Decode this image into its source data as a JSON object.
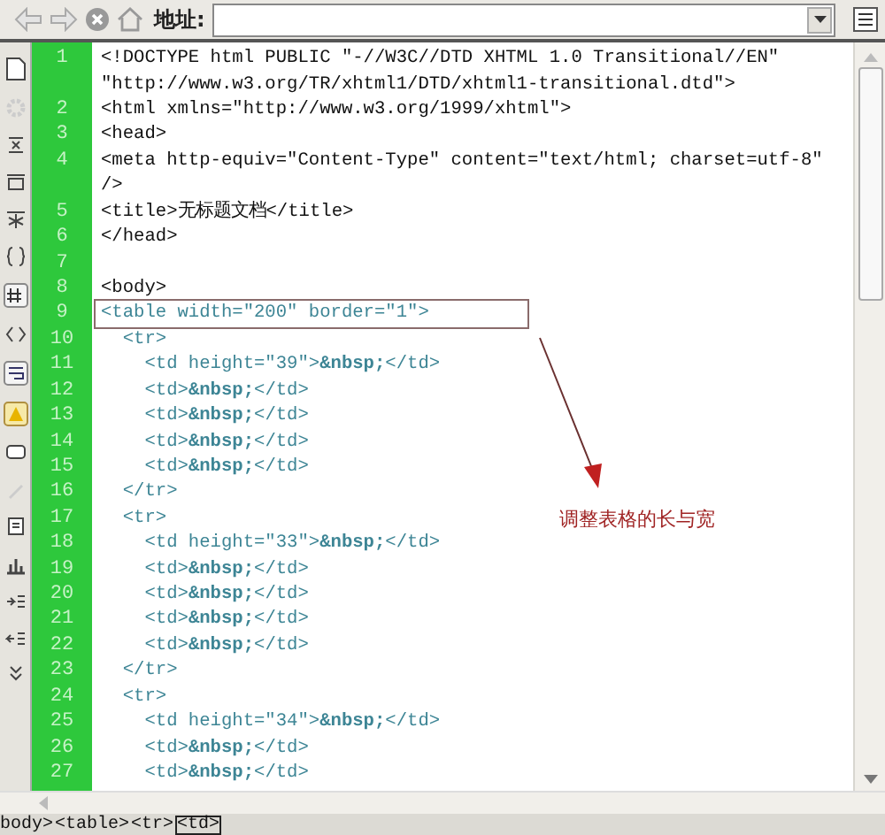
{
  "toolbar": {
    "address_label": "地址:"
  },
  "code_rows": [
    {
      "number": "1",
      "kind": "plain",
      "text": "<!DOCTYPE html PUBLIC \"-//W3C//DTD XHTML 1.0 Transitional//EN\""
    },
    {
      "kind": "plain",
      "text": "\"http://www.w3.org/TR/xhtml1/DTD/xhtml1-transitional.dtd\">"
    },
    {
      "number": "2",
      "kind": "plain",
      "text": "<html xmlns=\"http://www.w3.org/1999/xhtml\">"
    },
    {
      "number": "3",
      "kind": "plain",
      "text": "<head>"
    },
    {
      "number": "4",
      "kind": "plain",
      "text": "<meta http-equiv=\"Content-Type\" content=\"text/html; charset=utf-8\""
    },
    {
      "kind": "plain",
      "text": "/>"
    },
    {
      "number": "5",
      "kind": "plain",
      "text": "<title>无标题文档</title>"
    },
    {
      "number": "6",
      "kind": "plain",
      "text": "</head>"
    },
    {
      "number": "7"
    },
    {
      "number": "8",
      "kind": "plain",
      "text": "<body>"
    },
    {
      "number": "9",
      "kind": "tag",
      "boxed": true,
      "text": "<table width=\"200\" border=\"1\">"
    },
    {
      "number": "10",
      "kind": "tag",
      "text": "  <tr>"
    },
    {
      "number": "11",
      "kind": "tag",
      "text": "    <td height=\"39\">**&nbsp;**</td>"
    },
    {
      "number": "12",
      "kind": "tag",
      "text": "    <td>**&nbsp;**</td>"
    },
    {
      "number": "13",
      "kind": "tag",
      "text": "    <td>**&nbsp;**</td>"
    },
    {
      "number": "14",
      "kind": "tag",
      "text": "    <td>**&nbsp;**</td>"
    },
    {
      "number": "15",
      "kind": "tag",
      "text": "    <td>**&nbsp;**</td>"
    },
    {
      "number": "16",
      "kind": "tag",
      "text": "  </tr>"
    },
    {
      "number": "17",
      "kind": "tag",
      "text": "  <tr>"
    },
    {
      "number": "18",
      "kind": "tag",
      "text": "    <td height=\"33\">**&nbsp;**</td>"
    },
    {
      "number": "19",
      "kind": "tag",
      "text": "    <td>**&nbsp;**</td>"
    },
    {
      "number": "20",
      "kind": "tag",
      "text": "    <td>**&nbsp;**</td>"
    },
    {
      "number": "21",
      "kind": "tag",
      "text": "    <td>**&nbsp;**</td>"
    },
    {
      "number": "22",
      "kind": "tag",
      "text": "    <td>**&nbsp;**</td>"
    },
    {
      "number": "23",
      "kind": "tag",
      "text": "  </tr>"
    },
    {
      "number": "24",
      "kind": "tag",
      "text": "  <tr>"
    },
    {
      "number": "25",
      "kind": "tag",
      "text": "    <td height=\"34\">**&nbsp;**</td>"
    },
    {
      "number": "26",
      "kind": "tag",
      "text": "    <td>**&nbsp;**</td>"
    },
    {
      "number": "27",
      "kind": "tag",
      "text": "    <td>**&nbsp;**</td>"
    }
  ],
  "annotation": {
    "label": "调整表格的长与宽"
  },
  "tag_selector": [
    {
      "label": "body>",
      "selected": false
    },
    {
      "label": "<table>",
      "selected": false
    },
    {
      "label": "<tr>",
      "selected": false
    },
    {
      "label": "<td>",
      "selected": true
    }
  ]
}
